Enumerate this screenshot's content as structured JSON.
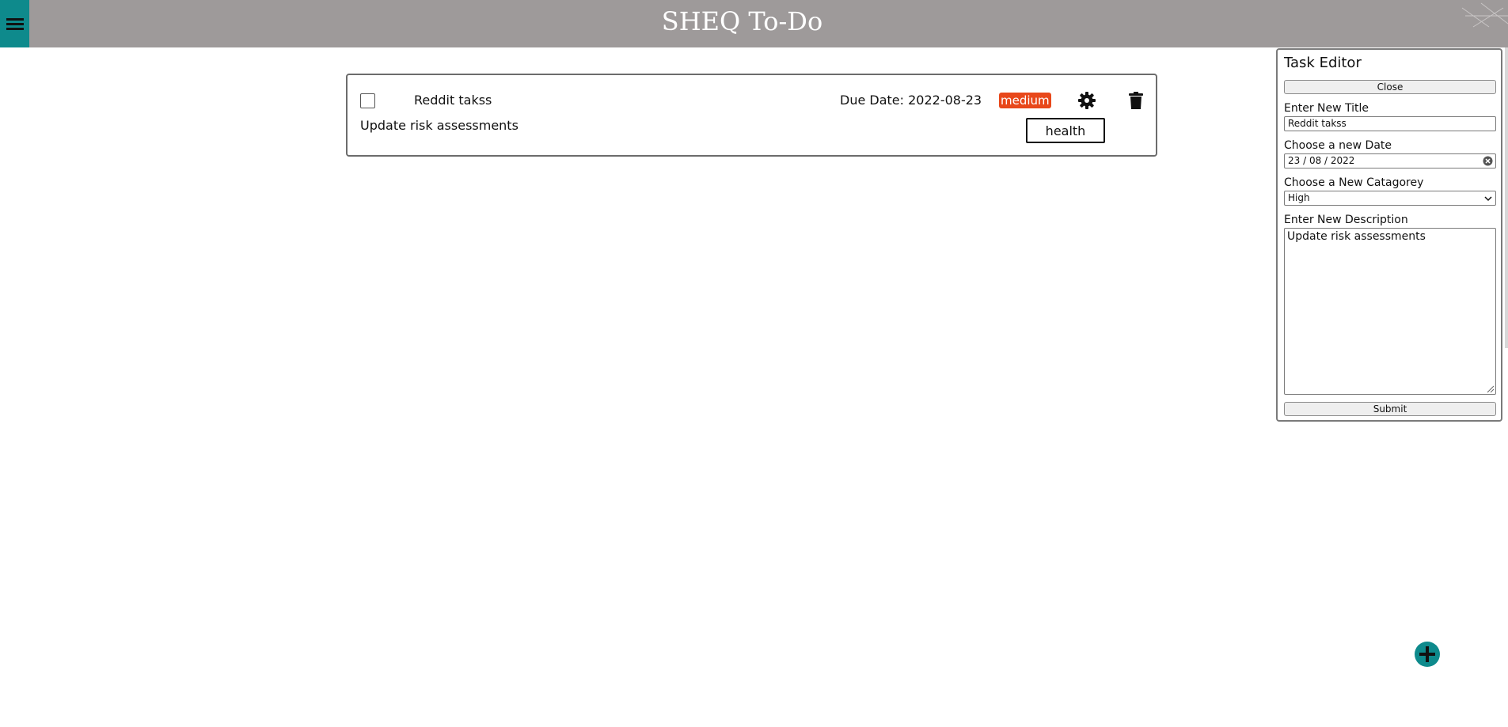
{
  "header": {
    "title": "SHEQ To-Do",
    "menu_icon": "hamburger-icon"
  },
  "task": {
    "title": "Reddit takss",
    "description": "Update risk assessments",
    "due_label": "Due Date:",
    "due_date": "2022-08-23",
    "priority": "medium",
    "category": "health",
    "completed": false,
    "settings_icon": "gear-icon",
    "delete_icon": "trash-icon"
  },
  "editor": {
    "heading": "Task Editor",
    "close_label": "Close",
    "title_label": "Enter New Title",
    "title_value": "Reddit takss",
    "date_label": "Choose a new Date",
    "date_value": "23 / 08 / 2022",
    "category_label": "Choose a New Catagorey",
    "category_value": "High",
    "description_label": "Enter New Description",
    "description_value": "Update risk assessments",
    "submit_label": "Submit"
  },
  "fab": {
    "icon": "plus-icon"
  },
  "colors": {
    "header_bg": "#9e9a9a",
    "accent_teal": "#0e8a8c",
    "priority_medium": "#e8481b"
  }
}
